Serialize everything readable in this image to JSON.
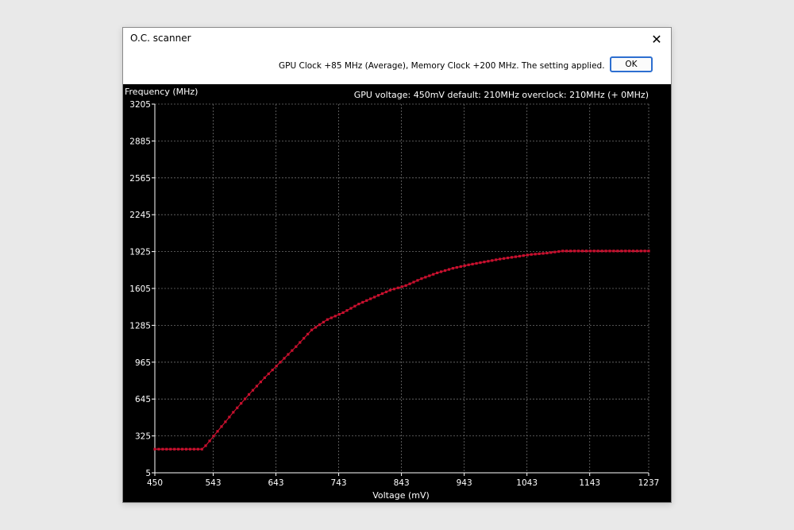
{
  "window": {
    "title": "O.C. scanner",
    "close_glyph": "✕",
    "message": "GPU Clock +85 MHz (Average), Memory Clock +200 MHz. The setting applied.",
    "ok_label": "OK"
  },
  "graph": {
    "ylabel": "Frequency (MHz)",
    "xlabel": "Voltage (mV)",
    "info": "GPU voltage: 450mV default:  210MHz overclock:  210MHz (+  0MHz)",
    "curve_color": "#c8102e"
  },
  "chart_data": {
    "type": "line",
    "xlabel": "Voltage (mV)",
    "ylabel": "Frequency (MHz)",
    "x_ticks": [
      "450",
      "543",
      "643",
      "743",
      "843",
      "943",
      "1043",
      "1143",
      "1237"
    ],
    "y_ticks": [
      "5",
      "325",
      "645",
      "965",
      "1285",
      "1605",
      "1925",
      "2245",
      "2565",
      "2885",
      "3205"
    ],
    "xlim": [
      450,
      1237
    ],
    "ylim": [
      5,
      3205
    ],
    "grid": true,
    "series": [
      {
        "markers": true,
        "x": [
          450,
          475,
          500,
          525,
          531,
          550,
          575,
          600,
          625,
          650,
          675,
          700,
          725,
          750,
          775,
          800,
          825,
          850,
          875,
          900,
          925,
          950,
          975,
          1000,
          1025,
          1050,
          1075,
          1100,
          1125,
          1150,
          1175,
          1200,
          1237
        ],
        "y": [
          210,
          210,
          210,
          210,
          240,
          365,
          530,
          685,
          830,
          965,
          1100,
          1245,
          1335,
          1395,
          1470,
          1530,
          1590,
          1630,
          1690,
          1740,
          1780,
          1810,
          1835,
          1860,
          1880,
          1900,
          1912,
          1930,
          1930,
          1930,
          1930,
          1930,
          1930
        ]
      }
    ]
  }
}
